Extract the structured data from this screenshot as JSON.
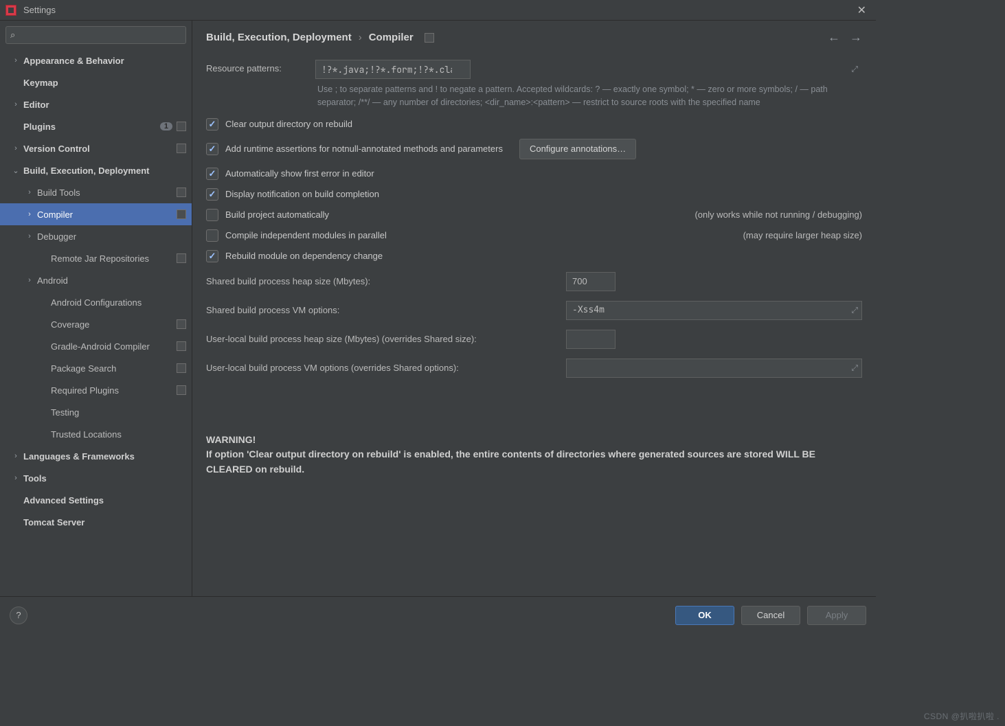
{
  "window": {
    "title": "Settings"
  },
  "search": {
    "placeholder": ""
  },
  "sidebar": {
    "items": [
      {
        "label": "Appearance & Behavior",
        "bold": true,
        "chev": "›",
        "indent": 0
      },
      {
        "label": "Keymap",
        "bold": true,
        "indent": 0
      },
      {
        "label": "Editor",
        "bold": true,
        "chev": "›",
        "indent": 0
      },
      {
        "label": "Plugins",
        "bold": true,
        "indent": 0,
        "count": "1",
        "proj": true
      },
      {
        "label": "Version Control",
        "bold": true,
        "chev": "›",
        "indent": 0,
        "proj": true
      },
      {
        "label": "Build, Execution, Deployment",
        "bold": true,
        "chev": "⌄",
        "indent": 0
      },
      {
        "label": "Build Tools",
        "chev": "›",
        "indent": 1,
        "proj": true
      },
      {
        "label": "Compiler",
        "chev": "›",
        "indent": 1,
        "proj": true,
        "selected": true
      },
      {
        "label": "Debugger",
        "chev": "›",
        "indent": 1
      },
      {
        "label": "Remote Jar Repositories",
        "indent": 2,
        "proj": true
      },
      {
        "label": "Android",
        "chev": "›",
        "indent": 1
      },
      {
        "label": "Android Configurations",
        "indent": 2
      },
      {
        "label": "Coverage",
        "indent": 2,
        "proj": true
      },
      {
        "label": "Gradle-Android Compiler",
        "indent": 2,
        "proj": true
      },
      {
        "label": "Package Search",
        "indent": 2,
        "proj": true
      },
      {
        "label": "Required Plugins",
        "indent": 2,
        "proj": true
      },
      {
        "label": "Testing",
        "indent": 2
      },
      {
        "label": "Trusted Locations",
        "indent": 2
      },
      {
        "label": "Languages & Frameworks",
        "bold": true,
        "chev": "›",
        "indent": 0
      },
      {
        "label": "Tools",
        "bold": true,
        "chev": "›",
        "indent": 0
      },
      {
        "label": "Advanced Settings",
        "bold": true,
        "indent": 0
      },
      {
        "label": "Tomcat Server",
        "bold": true,
        "indent": 0
      }
    ]
  },
  "breadcrumbs": {
    "a": "Build, Execution, Deployment",
    "b": "Compiler"
  },
  "form": {
    "resource_label": "Resource patterns:",
    "resource_value": "!?*.java;!?*.form;!?*.class;!?*.groovy;!?*.scala;!?*.flex;!?*.kt;!?*.clj;!?*.aj",
    "help1": "Use ; to separate patterns and ! to negate a pattern. Accepted wildcards: ? — exactly one symbol; * — zero or more symbols; / — path separator; /**/ — any number of directories; <dir_name>:<pattern> — restrict to source roots with the specified name",
    "checks": [
      {
        "label": "Clear output directory on rebuild",
        "checked": true
      },
      {
        "label": "Add runtime assertions for notnull-annotated methods and parameters",
        "checked": true,
        "button": "Configure annotations…"
      },
      {
        "label": "Automatically show first error in editor",
        "checked": true
      },
      {
        "label": "Display notification on build completion",
        "checked": true
      },
      {
        "label": "Build project automatically",
        "checked": false,
        "note": "(only works while not running / debugging)"
      },
      {
        "label": "Compile independent modules in parallel",
        "checked": false,
        "note": "(may require larger heap size)"
      },
      {
        "label": "Rebuild module on dependency change",
        "checked": true
      }
    ],
    "kv": [
      {
        "label": "Shared build process heap size (Mbytes):",
        "value": "700",
        "kind": "small"
      },
      {
        "label": "Shared build process VM options:",
        "value": "-Xss4m",
        "kind": "wide"
      },
      {
        "label": "User-local build process heap size (Mbytes) (overrides Shared size):",
        "value": "",
        "kind": "small"
      },
      {
        "label": "User-local build process VM options (overrides Shared options):",
        "value": "",
        "kind": "wide"
      }
    ],
    "warning_title": "WARNING!",
    "warning_body": "If option 'Clear output directory on rebuild' is enabled, the entire contents of directories where generated sources are stored WILL BE CLEARED on rebuild."
  },
  "footer": {
    "ok": "OK",
    "cancel": "Cancel",
    "apply": "Apply"
  },
  "watermark": "CSDN @扒啦扒啦 ."
}
